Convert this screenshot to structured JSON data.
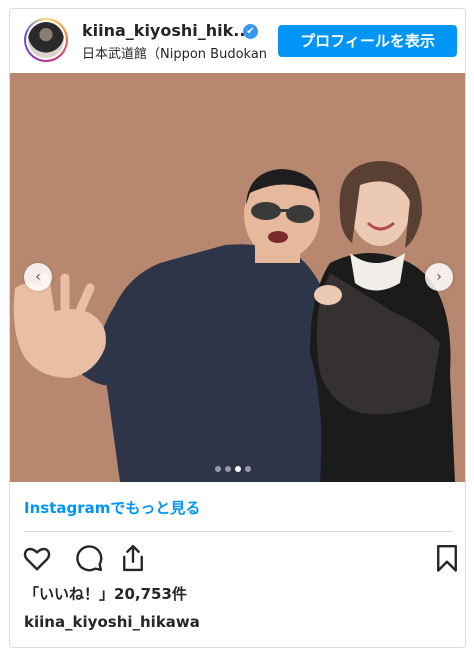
{
  "header": {
    "username": "kiina_kiyoshi_hik...",
    "location": "日本武道館（Nippon Budokan",
    "profile_button": "プロフィールを表示",
    "verified_icon": "✔"
  },
  "carousel": {
    "prev_icon": "‹",
    "next_icon": "›",
    "slide_count": 4,
    "active_slide": 3
  },
  "more_link": "Instagramでもっと見る",
  "likes_text": "「いいね！」20,753件",
  "caption_username": "kiina_kiyoshi_hikawa",
  "colors": {
    "accent": "#0095f6",
    "photo_background": "#b7886f"
  }
}
